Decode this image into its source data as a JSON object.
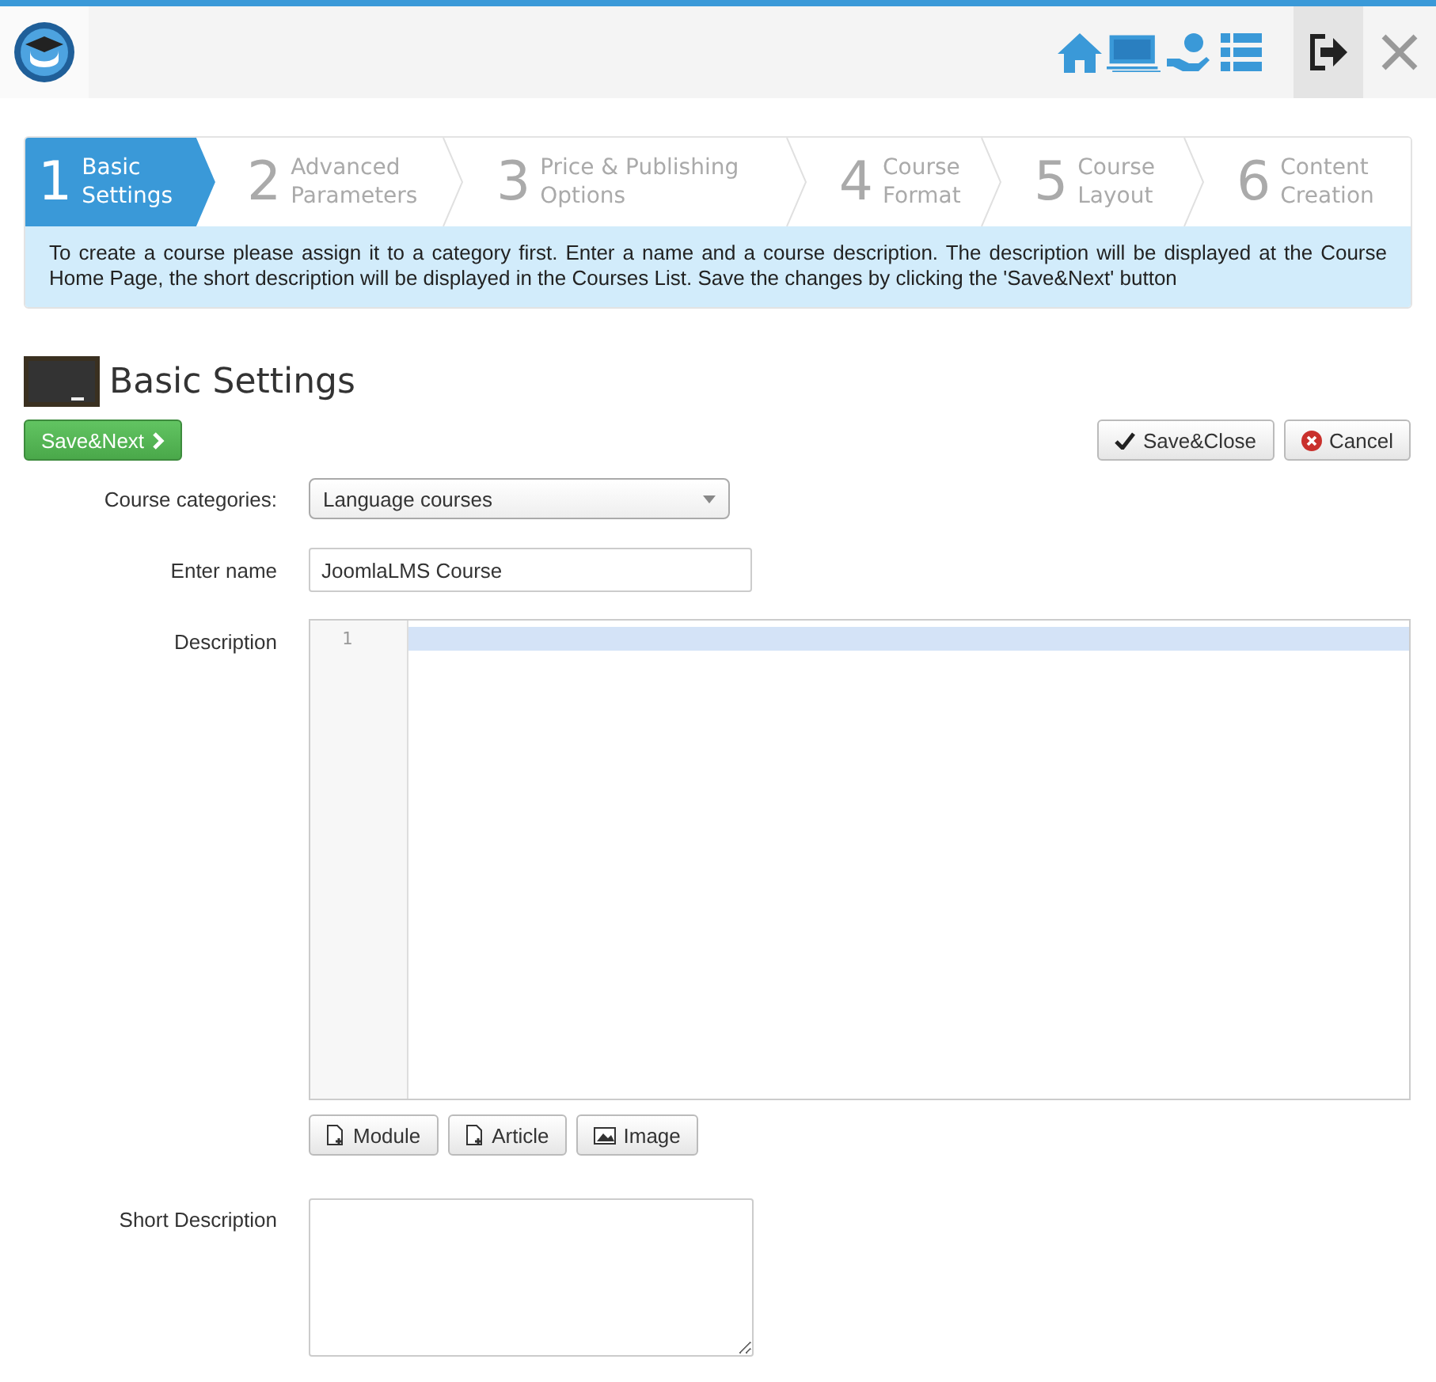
{
  "wizard": {
    "steps": [
      {
        "number": "1",
        "label": "Basic\nSettings",
        "selected": true
      },
      {
        "number": "2",
        "label": "Advanced\nParameters",
        "selected": false
      },
      {
        "number": "3",
        "label": "Price & Publishing\nOptions",
        "selected": false
      },
      {
        "number": "4",
        "label": "Course\nFormat",
        "selected": false
      },
      {
        "number": "5",
        "label": "Course\nLayout",
        "selected": false
      },
      {
        "number": "6",
        "label": "Content\nCreation",
        "selected": false
      }
    ],
    "info": "To create a course please assign it to a category first. Enter a name and a course description. The description will be displayed at the Course Home Page, the short description will be displayed in the Courses List. Save the changes by clicking the 'Save&Next' button"
  },
  "heading": "Basic Settings",
  "actions": {
    "next": "Save&Next",
    "save_close": "Save&Close",
    "cancel": "Cancel"
  },
  "form": {
    "category_label": "Course categories:",
    "category_value": "Language courses",
    "name_label": "Enter name",
    "name_value": "JoomlaLMS Course",
    "description_label": "Description",
    "line_numbers": [
      "1"
    ],
    "insert_buttons": [
      {
        "kind": "module",
        "label": "Module"
      },
      {
        "kind": "article",
        "label": "Article"
      },
      {
        "kind": "image",
        "label": "Image"
      }
    ],
    "short_label": "Short Description"
  }
}
